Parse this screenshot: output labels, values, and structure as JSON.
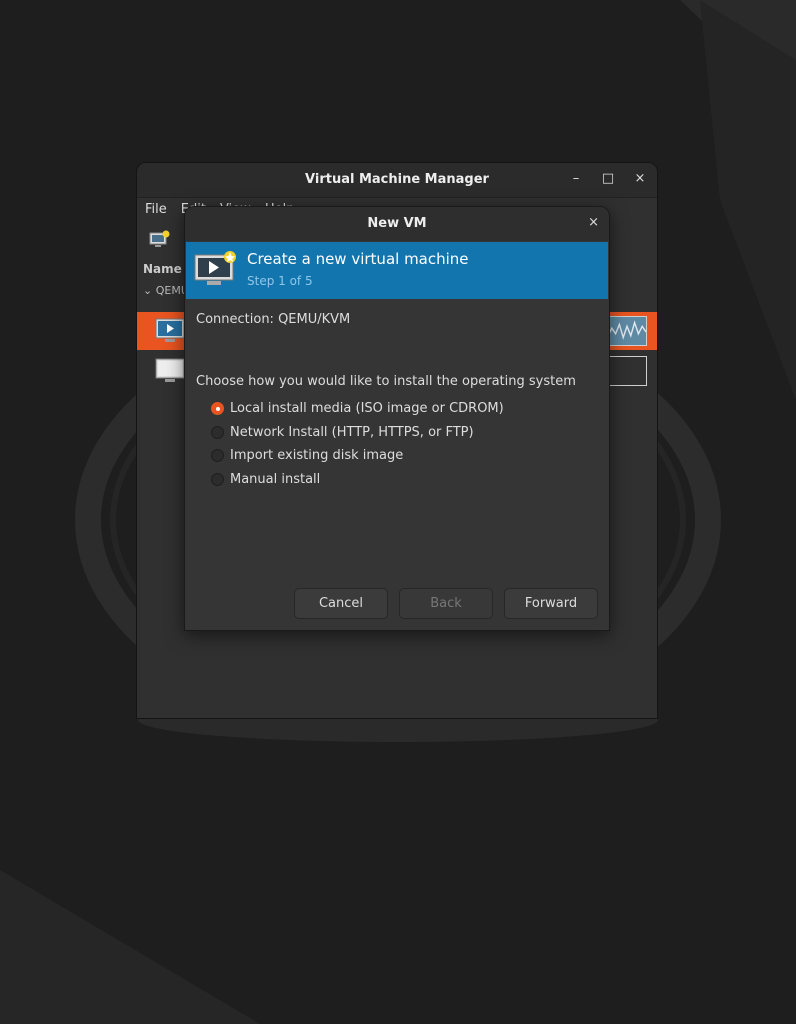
{
  "main_window": {
    "title": "Virtual Machine Manager",
    "menu": [
      "File",
      "Edit",
      "View",
      "Help"
    ],
    "column_header": "Name",
    "group_label": "QEMU",
    "controls": {
      "minimize": "–",
      "maximize": "□",
      "close": "×"
    }
  },
  "dialog": {
    "title": "New VM",
    "close": "×",
    "banner": {
      "title": "Create a new virtual machine",
      "step": "Step 1 of 5"
    },
    "connection": "Connection:  QEMU/KVM",
    "prompt": "Choose how you would like to install the operating system",
    "options": [
      {
        "label": "Local install media (ISO image or CDROM)",
        "selected": true
      },
      {
        "label": "Network Install (HTTP, HTTPS, or FTP)",
        "selected": false
      },
      {
        "label": "Import existing disk image",
        "selected": false
      },
      {
        "label": "Manual install",
        "selected": false
      }
    ],
    "buttons": {
      "cancel": "Cancel",
      "back": "Back",
      "forward": "Forward"
    }
  },
  "colors": {
    "accent": "#e95420",
    "banner": "#1375ad",
    "background": "#1e1e1e"
  }
}
